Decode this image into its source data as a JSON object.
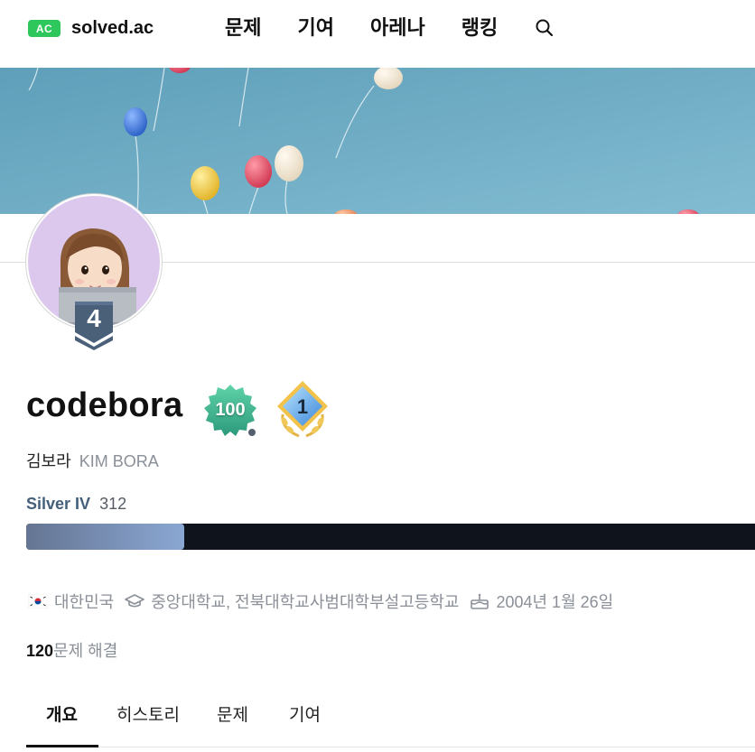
{
  "nav": {
    "brand_badge": "AC",
    "brand_name": "solved.ac",
    "items": [
      "문제",
      "기여",
      "아레나",
      "랭킹"
    ],
    "search_icon": "search-icon"
  },
  "profile": {
    "handle": "codebora",
    "badge_label": "100",
    "arena_label": "1",
    "rank_level": "4",
    "name_korean": "김보라",
    "name_latin": "KIM BORA",
    "tier_name": "Silver IV",
    "rating": "312",
    "rating_progress": 0.217,
    "country": "대한민국",
    "school": "중앙대학교, 전북대학교사범대학부설고등학교",
    "birthday": "2004년 1월 26일",
    "solved_count": "120",
    "solved_label": "문제 해결"
  },
  "tabs": [
    "개요",
    "히스토리",
    "문제",
    "기여"
  ],
  "active_tab": "개요",
  "colors": {
    "brand_green": "#2dc75c",
    "tier_silver": "#435f7a",
    "banner_sky": "#6faec6",
    "avatar_bg": "#dcc8ec",
    "progress_track": "#0f141c"
  }
}
